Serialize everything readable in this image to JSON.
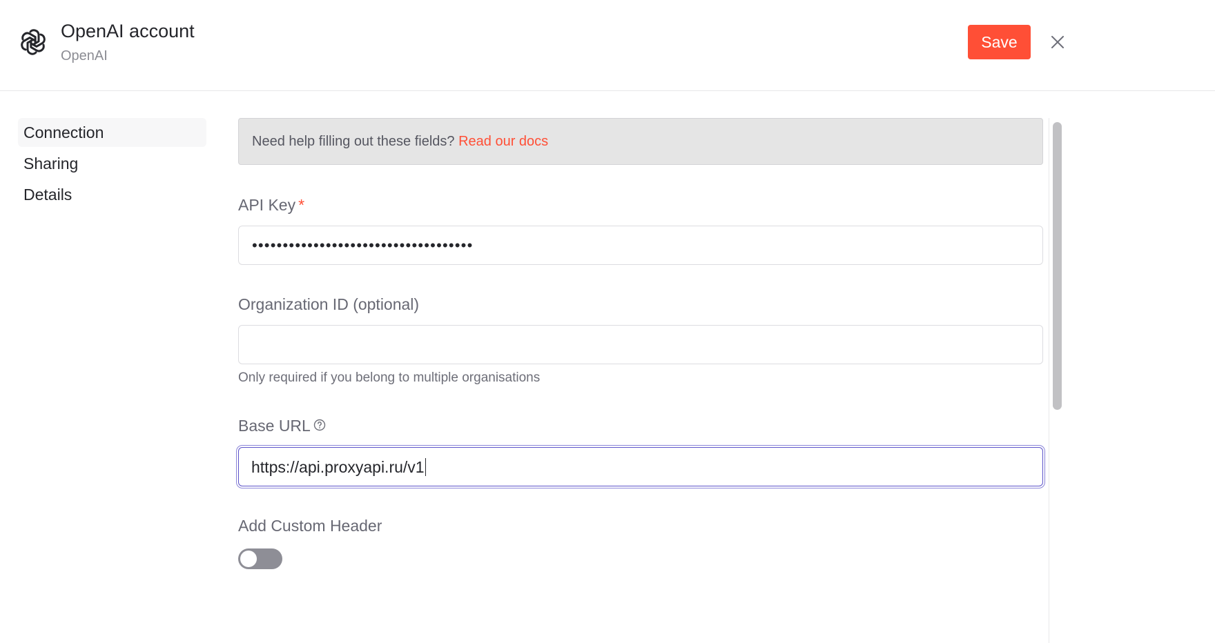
{
  "header": {
    "title": "OpenAI account",
    "subtitle": "OpenAI",
    "logo_icon": "openai-logo-icon",
    "save_label": "Save",
    "close_icon": "close-icon"
  },
  "sidebar": {
    "items": [
      {
        "label": "Connection",
        "active": true
      },
      {
        "label": "Sharing",
        "active": false
      },
      {
        "label": "Details",
        "active": false
      }
    ]
  },
  "help": {
    "text": "Need help filling out these fields?",
    "link": "Read our docs"
  },
  "fields": {
    "api_key": {
      "label": "API Key",
      "required_mark": "*",
      "value_masked": "••••••••••••••••••••••••••••••••••••"
    },
    "organization_id": {
      "label": "Organization ID (optional)",
      "value": "",
      "hint": "Only required if you belong to multiple organisations"
    },
    "base_url": {
      "label": "Base URL",
      "help_icon": "question-circle-icon",
      "value": "https://api.proxyapi.ru/v1"
    },
    "custom_header": {
      "label": "Add Custom Header",
      "enabled": false
    }
  },
  "colors": {
    "accent": "#ff4f36",
    "focus": "#5b52c9",
    "help_box_bg": "#e5e5e5",
    "toggle_off": "#8e8e96"
  }
}
